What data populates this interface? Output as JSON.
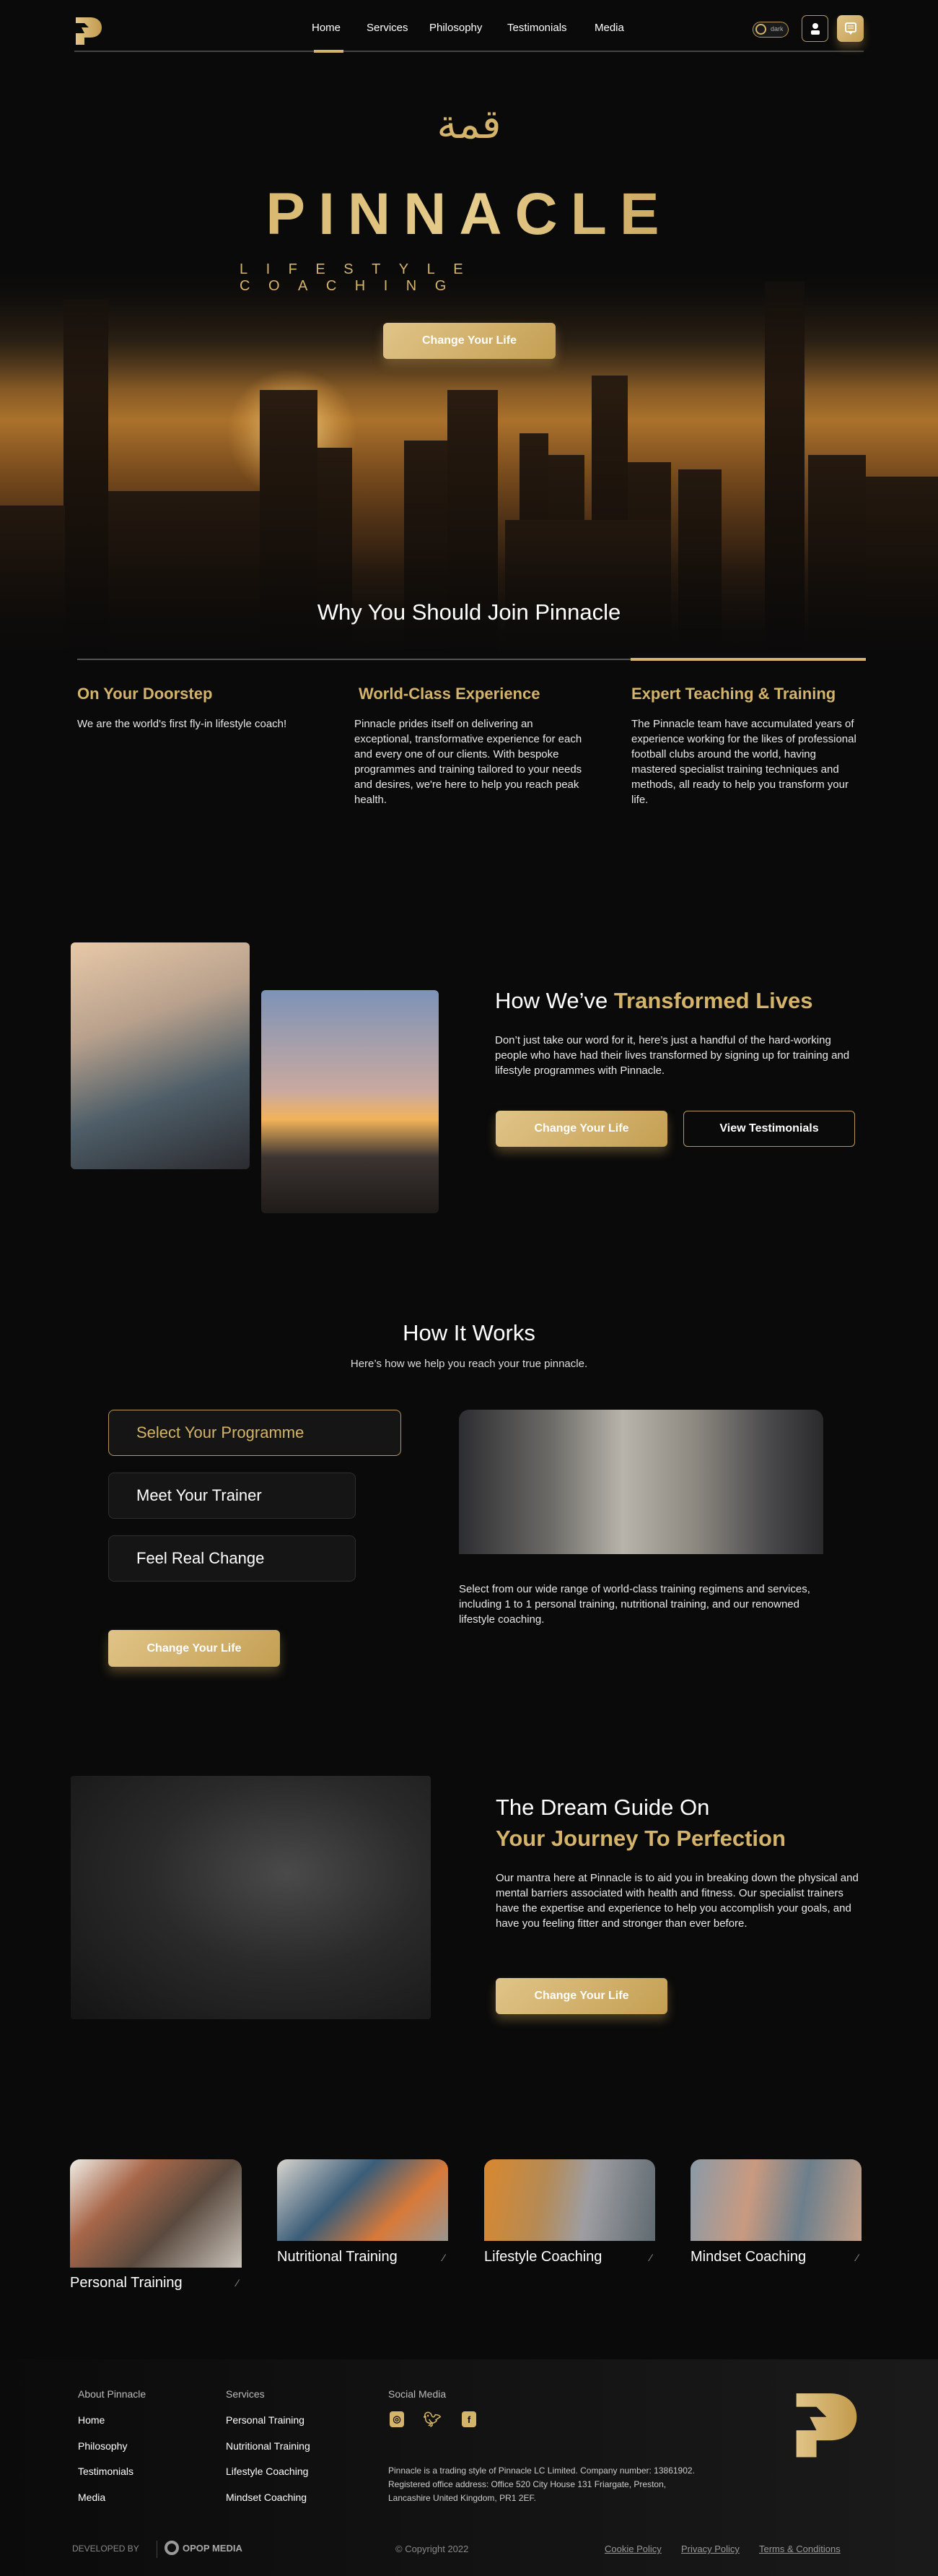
{
  "nav": {
    "items": [
      "Home",
      "Services",
      "Philosophy",
      "Testimonials",
      "Media"
    ],
    "active": "Home",
    "toggle_label": "dark"
  },
  "hero": {
    "arabic_mark": "قمة",
    "brand": "PINNACLE",
    "tagline": "LIFESTYLE COACHING",
    "cta": "Change Your Life"
  },
  "why": {
    "title": "Why You Should Join Pinnacle",
    "columns": [
      {
        "heading": "On Your Doorstep",
        "text": "We are the world's first fly-in lifestyle coach!"
      },
      {
        "heading": "World-Class Experience",
        "text": "Pinnacle prides itself on delivering an exceptional, transformative experience for each and every one of our clients. With bespoke programmes and training tailored to your needs and desires, we're here to help you reach peak health."
      },
      {
        "heading": "Expert Teaching & Training",
        "text": "The Pinnacle team have accumulated years of experience working for the likes of professional football clubs around the world, having mastered specialist training techniques and methods, all ready to help you transform your life."
      }
    ]
  },
  "transformed": {
    "title_plain": "How We’ve ",
    "title_gold": "Transformed Lives",
    "text": "Don’t just take our word for it, here’s just a handful of the hard-working people who have had their lives transformed by signing up for training and lifestyle programmes with Pinnacle.",
    "cta": "Change Your Life",
    "secondary": "View Testimonials"
  },
  "how": {
    "title": "How It Works",
    "subtitle": "Here’s how we help you reach your true pinnacle.",
    "steps": [
      "Select Your Programme",
      "Meet Your Trainer",
      "Feel Real Change"
    ],
    "active_step": "Select Your Programme",
    "text": "Select from our wide range of world-class training regimens and services, including 1 to 1 personal training, nutritional training, and our renowned lifestyle coaching.",
    "cta": "Change Your Life"
  },
  "dream": {
    "title_plain": "The Dream Guide On",
    "title_gold": "Your Journey To Perfection",
    "text": "Our mantra here at Pinnacle is to aid you in breaking down the physical and mental barriers associated with health and fitness. Our specialist trainers have the expertise and experience to help you accomplish your goals, and have you feeling fitter and stronger than ever before.",
    "cta": "Change Your Life"
  },
  "services": [
    "Personal Training",
    "Nutritional Training",
    "Lifestyle Coaching",
    "Mindset Coaching"
  ],
  "footer": {
    "about_heading": "About Pinnacle",
    "about_links": [
      "Home",
      "Philosophy",
      "Testimonials",
      "Media"
    ],
    "services_heading": "Services",
    "services_links": [
      "Personal Training",
      "Nutritional Training",
      "Lifestyle Coaching",
      "Mindset Coaching"
    ],
    "social_heading": "Social Media",
    "social_icons": [
      "instagram-icon",
      "twitter-icon",
      "facebook-icon"
    ],
    "legal": "Pinnacle is a trading style of Pinnacle LC Limited. Company number: 13861902. Registered office address: Office 520 City House 131 Friargate, Preston, Lancashire United Kingdom, PR1 2EF.",
    "developed_by": "DEVELOPED BY",
    "developer": "OPOP MEDIA",
    "copyright": "© Copyright 2022",
    "policy_links": [
      "Cookie Policy",
      "Privacy Policy",
      "Terms & Conditions"
    ]
  },
  "colors": {
    "gold": "#d4b36b",
    "background": "#0a0a0a"
  }
}
